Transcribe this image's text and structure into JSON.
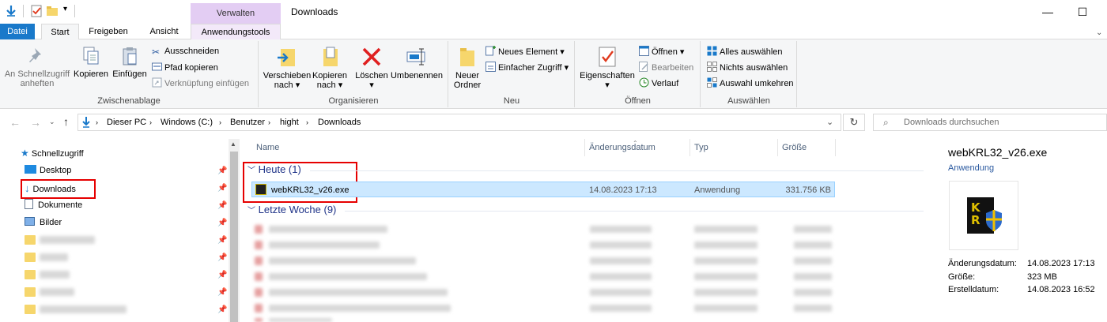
{
  "window": {
    "title": "Downloads",
    "minimize": "—",
    "maximize": "☐"
  },
  "context_header": "Verwalten",
  "tabs": {
    "datei": "Datei",
    "start": "Start",
    "freigeben": "Freigeben",
    "ansicht": "Ansicht",
    "anwendungstools": "Anwendungstools"
  },
  "ribbon": {
    "zwischenablage": {
      "label": "Zwischenablage",
      "pin": "An Schnellzugriff\nanheften",
      "pin_l1": "An Schnellzugriff",
      "pin_l2": "anheften",
      "kopieren": "Kopieren",
      "einfuegen": "Einfügen",
      "ausschneiden": "Ausschneiden",
      "pfad_kopieren": "Pfad kopieren",
      "verknuepfung": "Verknüpfung einfügen"
    },
    "organisieren": {
      "label": "Organisieren",
      "verschieben_l1": "Verschieben",
      "verschieben_l2": "nach",
      "kopieren_l1": "Kopieren",
      "kopieren_l2": "nach",
      "loeschen": "Löschen",
      "umbenennen": "Umbenennen"
    },
    "neu": {
      "label": "Neu",
      "ordner_l1": "Neuer",
      "ordner_l2": "Ordner",
      "neues_element": "Neues Element",
      "einfacher_zugriff": "Einfacher Zugriff"
    },
    "oeffnen": {
      "label": "Öffnen",
      "eigenschaften": "Eigenschaften",
      "oeffnen": "Öffnen",
      "bearbeiten": "Bearbeiten",
      "verlauf": "Verlauf"
    },
    "auswaehlen": {
      "label": "Auswählen",
      "alles": "Alles auswählen",
      "nichts": "Nichts auswählen",
      "umkehren": "Auswahl umkehren"
    }
  },
  "address": {
    "crumbs": [
      "Dieser PC",
      "Windows (C:)",
      "Benutzer",
      "hight",
      "Downloads"
    ],
    "search_placeholder": "Downloads durchsuchen"
  },
  "nav": {
    "schnellzugriff": "Schnellzugriff",
    "desktop": "Desktop",
    "downloads": "Downloads",
    "dokumente": "Dokumente",
    "bilder": "Bilder"
  },
  "columns": {
    "name": "Name",
    "date": "Änderungsdatum",
    "type": "Typ",
    "size": "Größe"
  },
  "groups": {
    "today": "Heute (1)",
    "last_week": "Letzte Woche (9)"
  },
  "selected_file": {
    "name": "webKRL32_v26.exe",
    "date": "14.08.2023 17:13",
    "type": "Anwendung",
    "size": "331.756 KB"
  },
  "details": {
    "name": "webKRL32_v26.exe",
    "type": "Anwendung",
    "modified_label": "Änderungsdatum:",
    "modified": "14.08.2023 17:13",
    "size_label": "Größe:",
    "size": "323 MB",
    "created_label": "Erstelldatum:",
    "created": "14.08.2023 16:52"
  },
  "colors": {
    "accent": "#1979ca",
    "context": "#e3cdf3",
    "selection": "#cce8ff",
    "highlight": "#e60000",
    "group": "#1e3287"
  }
}
